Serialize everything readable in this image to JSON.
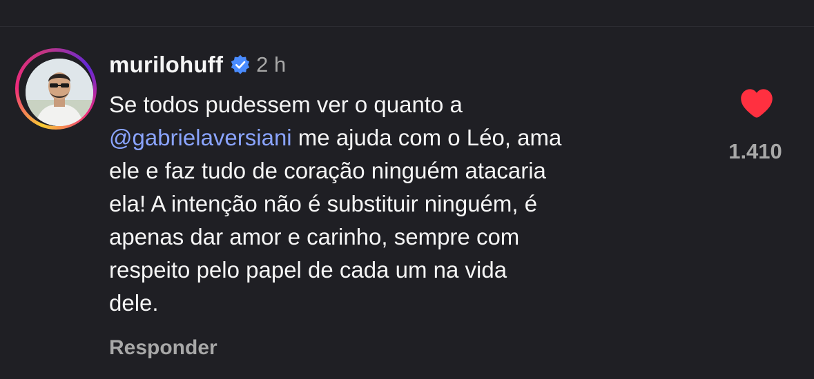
{
  "comment": {
    "username": "murilohuff",
    "verified_icon": "verified-badge-icon",
    "time": "2 h",
    "text_lines": [
      "Se todos pudessem ver o quanto a",
      " me ajuda com o Léo, ama",
      "ele e faz tudo de coração ninguém atacaria",
      "ela! A intenção não é substituir ninguém, é",
      "apenas dar amor e carinho, sempre com",
      "respeito pelo papel de cada um na vida",
      "dele."
    ],
    "mention": "@gabrielaversiani",
    "reply_label": "Responder",
    "like_icon": "heart-icon",
    "like_count": "1.410"
  },
  "colors": {
    "background": "#1f1f24",
    "text": "#f5f5f5",
    "secondary": "#a8a8a8",
    "mention": "#8aa4ff",
    "heart": "#ff3040",
    "verified": "#4a8cff"
  }
}
